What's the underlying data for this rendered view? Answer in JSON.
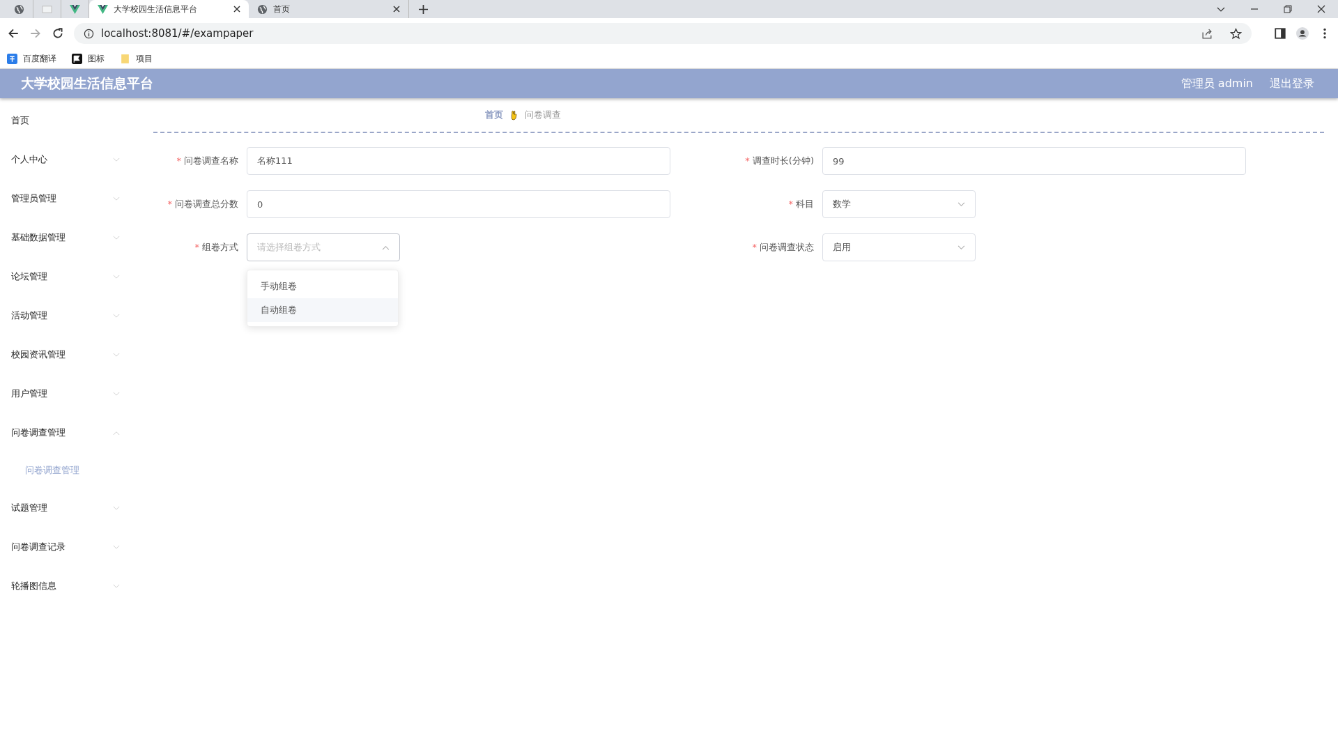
{
  "browser": {
    "tabs": [
      {
        "kind": "pinned",
        "selected": false
      },
      {
        "kind": "pinned",
        "selected": false
      },
      {
        "kind": "pinned",
        "selected": false
      },
      {
        "kind": "normal",
        "title": "大学校园生活信息平台",
        "selected": true
      },
      {
        "kind": "normal",
        "title": "首页",
        "selected": false
      }
    ],
    "address": "localhost:8081/#/exampaper",
    "bookmarks": [
      {
        "label": "百度翻译"
      },
      {
        "label": "图标"
      },
      {
        "label": "项目"
      }
    ]
  },
  "header": {
    "title": "大学校园生活信息平台",
    "user": "管理员 admin",
    "logout": "退出登录"
  },
  "sidebar": {
    "items": [
      {
        "kind": "link",
        "label": "首页"
      },
      {
        "kind": "menu",
        "label": "个人中心",
        "expanded": false
      },
      {
        "kind": "menu",
        "label": "管理员管理",
        "expanded": false
      },
      {
        "kind": "menu",
        "label": "基础数据管理",
        "expanded": false
      },
      {
        "kind": "menu",
        "label": "论坛管理",
        "expanded": false
      },
      {
        "kind": "menu",
        "label": "活动管理",
        "expanded": false
      },
      {
        "kind": "menu",
        "label": "校园资讯管理",
        "expanded": false
      },
      {
        "kind": "menu",
        "label": "用户管理",
        "expanded": false
      },
      {
        "kind": "menu",
        "label": "问卷调查管理",
        "expanded": true,
        "children": [
          {
            "label": "问卷调查管理",
            "selected": true
          }
        ]
      },
      {
        "kind": "menu",
        "label": "试题管理",
        "expanded": false
      },
      {
        "kind": "menu",
        "label": "问卷调查记录",
        "expanded": false
      },
      {
        "kind": "menu",
        "label": "轮播图信息",
        "expanded": false
      }
    ]
  },
  "breadcrumb": [
    "首页",
    "问卷调查"
  ],
  "form": {
    "rows": [
      [
        {
          "kind": "input",
          "required_mark": "*",
          "label": "问卷调查名称",
          "value": "名称111"
        },
        {
          "kind": "input",
          "required_mark": "*",
          "label": "调查时长(分钟)",
          "value": "99"
        }
      ],
      [
        {
          "kind": "input",
          "required_mark": "*",
          "label": "问卷调查总分数",
          "value": "0"
        },
        {
          "kind": "select",
          "required_mark": "*",
          "label": "科目",
          "value": "数学",
          "expanded": false
        }
      ],
      [
        {
          "kind": "select",
          "required_mark": "*",
          "label": "组卷方式",
          "placeholder": "请选择组卷方式",
          "expanded": true,
          "options": [
            {
              "label": "手动组卷",
              "hovered": false
            },
            {
              "label": "自动组卷",
              "hovered": true
            }
          ]
        },
        {
          "kind": "select",
          "required_mark": "*",
          "label": "问卷调查状态",
          "value": "启用",
          "expanded": false
        }
      ]
    ]
  }
}
